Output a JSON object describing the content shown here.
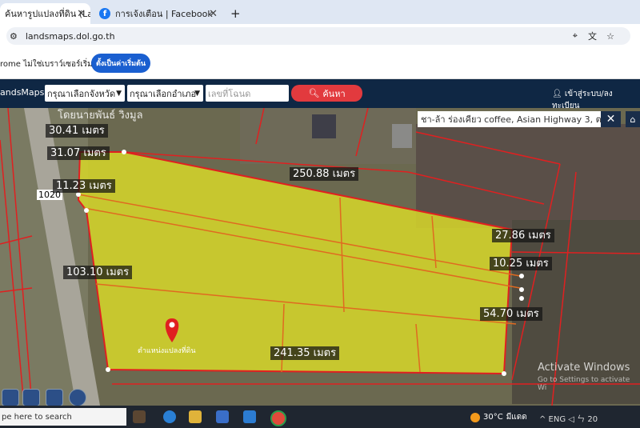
{
  "browser": {
    "tabs": [
      {
        "label": "ค้นหารูปแปลงที่ดิน (LandsMa",
        "active": true
      },
      {
        "label": "การเจ้งเตือน | Facebook",
        "active": false
      }
    ],
    "new_tab": "+",
    "url": "landsmaps.dol.go.th"
  },
  "infobar": {
    "text": "rome ไม่ใช่เบราว์เซอร์เริ่มต้น",
    "button": "ตั้งเป็นค่าเริ่มต้น"
  },
  "site": {
    "logo": "andsMaps",
    "province_select": "กรุณาเลือกจังหวัด",
    "district_select": "กรุณาเลือกอำเภอ",
    "parcel_placeholder": "เลขที่โฉนด",
    "search_button": "ค้นหา",
    "login": "เข้าสู่ระบบ/ลงทะเบียน"
  },
  "map": {
    "place_search": "ชา-ล้า ร่องเคียว coffee, Asian Highway 3, ต",
    "top_road_text": "โดยนายพันธ์ วิงมูล",
    "road_number": "1020",
    "parcel_marker_label": "ตำแหน่งแปลงที่ดิน",
    "measurements": [
      "30.41 เมตร",
      "31.07 เมตร",
      "11.23 เมตร",
      "250.88 เมตร",
      "27.86 เมตร",
      "10.25 เมตร",
      "103.10 เมตร",
      "54.70 เมตร",
      "241.35 เมตร"
    ],
    "watermark_title": "Activate Windows",
    "watermark_sub": "Go to Settings to activate Wi"
  },
  "taskbar": {
    "search": "pe here to search",
    "weather_temp": "30°C",
    "weather_text": "มีแดด",
    "tray": "^ ENG ◁ ㄣ 20"
  },
  "colors": {
    "parcel_fill": "#d4d42a",
    "boundary": "#e02020",
    "nav_bg": "#0f2744",
    "search_btn": "#e23a3e"
  }
}
